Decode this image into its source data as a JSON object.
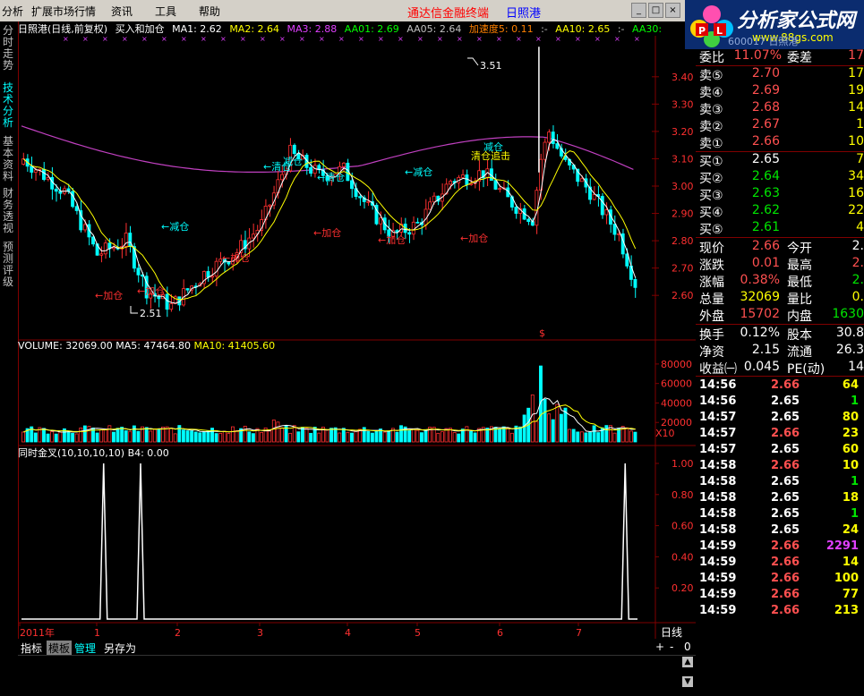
{
  "menu": [
    "分析",
    "扩展市场行情",
    "资讯",
    "工具",
    "帮助"
  ],
  "brand": {
    "title": "通达信金融终端",
    "stock": "日照港"
  },
  "logo": {
    "text": "分析家公式网",
    "url": "www.88gs.com",
    "code": "600017 日照港"
  },
  "side_tabs": [
    "分时走势",
    "技术分析",
    "基本资料",
    "财务透视",
    "预测评级"
  ],
  "info": {
    "name": "日照港(日线,前复权)",
    "formula": "买入和加仓",
    "items": [
      {
        "label": "MA1: 2.62",
        "color": "#ffffff"
      },
      {
        "label": "MA2: 2.64",
        "color": "#ffff00"
      },
      {
        "label": "MA3: 2.88",
        "color": "#e040ff"
      },
      {
        "label": "AA01: 2.69",
        "color": "#00ff00"
      },
      {
        "label": "AA05: 2.64",
        "color": "#c0c0c0"
      },
      {
        "label": "加速度5: 0.11",
        "color": "#ff8000"
      },
      {
        "label": ":-",
        "color": "#c0c0c0"
      },
      {
        "label": "AA10: 2.65",
        "color": "#ffff00"
      },
      {
        "label": ":-",
        "color": "#c0c0c0"
      },
      {
        "label": "AA30:",
        "color": "#00ff00"
      }
    ]
  },
  "price_axis": [
    "3.40",
    "3.30",
    "3.20",
    "3.10",
    "3.00",
    "2.90",
    "2.80",
    "2.70",
    "2.60"
  ],
  "annotations": {
    "high": "3.51",
    "low": "2.51",
    "dollar": "$",
    "labels": [
      {
        "text": "←加仓",
        "color": "#ff3030"
      },
      {
        "text": "←加仓",
        "color": "#ff3030"
      },
      {
        "text": "←减仓",
        "color": "#00ffff"
      },
      {
        "text": "←加仓",
        "color": "#ff3030"
      },
      {
        "text": "←清仓",
        "color": "#00ffff"
      },
      {
        "text": "减仓",
        "color": "#00ffff"
      },
      {
        "text": "←清仓",
        "color": "#00ffff"
      },
      {
        "text": "←加仓",
        "color": "#ff3030"
      },
      {
        "text": "←加仓",
        "color": "#ff3030"
      },
      {
        "text": "←减仓",
        "color": "#00ffff"
      },
      {
        "text": "←加仓",
        "color": "#ff3030"
      },
      {
        "text": "减仓",
        "color": "#00ffff"
      },
      {
        "text": "清仓追击",
        "color": "#ffff00"
      }
    ]
  },
  "volume": {
    "label": "VOLUME: 32069.00",
    "ma5": "MA5: 47464.80",
    "ma10": "MA10: 41405.60",
    "axis": [
      "80000",
      "60000",
      "40000",
      "20000"
    ],
    "unit": "X10"
  },
  "indicator": {
    "label": "同时金叉(10,10,10,10)",
    "b4": "B4: 0.00",
    "axis": [
      "1.00",
      "0.80",
      "0.60",
      "0.40",
      "0.20"
    ]
  },
  "time_axis": [
    "2011年",
    "1",
    "2",
    "3",
    "4",
    "5",
    "6",
    "7"
  ],
  "period": "日线",
  "bottom_tabs": [
    "指标",
    "模板",
    "管理",
    "另存为"
  ],
  "bottom_ctrl": [
    "+",
    "-",
    "0"
  ],
  "quote": {
    "weibi": {
      "label": "委比",
      "value": "11.07%",
      "label2": "委差",
      "value2": "17"
    },
    "asks": [
      {
        "label": "卖⑤",
        "price": "2.70",
        "vol": "17"
      },
      {
        "label": "卖④",
        "price": "2.69",
        "vol": "19"
      },
      {
        "label": "卖③",
        "price": "2.68",
        "vol": "14"
      },
      {
        "label": "卖②",
        "price": "2.67",
        "vol": "1"
      },
      {
        "label": "卖①",
        "price": "2.66",
        "vol": "10"
      }
    ],
    "bids": [
      {
        "label": "买①",
        "price": "2.65",
        "vol": "7"
      },
      {
        "label": "买②",
        "price": "2.64",
        "vol": "34"
      },
      {
        "label": "买③",
        "price": "2.63",
        "vol": "16"
      },
      {
        "label": "买④",
        "price": "2.62",
        "vol": "22"
      },
      {
        "label": "买⑤",
        "price": "2.61",
        "vol": "4"
      }
    ],
    "stats": [
      {
        "l": "现价",
        "v": "2.66",
        "vc": "red",
        "l2": "今开",
        "v2": "2.",
        "v2c": "white"
      },
      {
        "l": "涨跌",
        "v": "0.01",
        "vc": "red",
        "l2": "最高",
        "v2": "2.",
        "v2c": "red"
      },
      {
        "l": "涨幅",
        "v": "0.38%",
        "vc": "red",
        "l2": "最低",
        "v2": "2.",
        "v2c": "green"
      },
      {
        "l": "总量",
        "v": "32069",
        "vc": "yellow",
        "l2": "量比",
        "v2": "0.",
        "v2c": "yellow"
      },
      {
        "l": "外盘",
        "v": "15702",
        "vc": "red",
        "l2": "内盘",
        "v2": "1630",
        "v2c": "green"
      }
    ],
    "stats2": [
      {
        "l": "换手",
        "v": "0.12%",
        "l2": "股本",
        "v2": "30.8"
      },
      {
        "l": "净资",
        "v": "2.15",
        "l2": "流通",
        "v2": "26.3"
      },
      {
        "l": "收益㈠",
        "v": "0.045",
        "l2": "PE(动)",
        "v2": "14"
      }
    ],
    "ticks": [
      {
        "t": "14:56",
        "p": "2.66",
        "pc": "red",
        "q": "64",
        "qc": "yellow"
      },
      {
        "t": "14:56",
        "p": "2.65",
        "pc": "white",
        "q": "1",
        "qc": "green"
      },
      {
        "t": "14:57",
        "p": "2.65",
        "pc": "white",
        "q": "80",
        "qc": "yellow"
      },
      {
        "t": "14:57",
        "p": "2.66",
        "pc": "red",
        "q": "23",
        "qc": "yellow"
      },
      {
        "t": "14:57",
        "p": "2.65",
        "pc": "white",
        "q": "60",
        "qc": "yellow"
      },
      {
        "t": "14:58",
        "p": "2.66",
        "pc": "red",
        "q": "10",
        "qc": "yellow"
      },
      {
        "t": "14:58",
        "p": "2.65",
        "pc": "white",
        "q": "1",
        "qc": "green"
      },
      {
        "t": "14:58",
        "p": "2.65",
        "pc": "white",
        "q": "18",
        "qc": "yellow"
      },
      {
        "t": "14:58",
        "p": "2.65",
        "pc": "white",
        "q": "1",
        "qc": "green"
      },
      {
        "t": "14:58",
        "p": "2.65",
        "pc": "white",
        "q": "24",
        "qc": "yellow"
      },
      {
        "t": "14:59",
        "p": "2.66",
        "pc": "red",
        "q": "2291",
        "qc": "magenta"
      },
      {
        "t": "14:59",
        "p": "2.66",
        "pc": "red",
        "q": "14",
        "qc": "yellow"
      },
      {
        "t": "14:59",
        "p": "2.66",
        "pc": "red",
        "q": "100",
        "qc": "yellow"
      },
      {
        "t": "14:59",
        "p": "2.66",
        "pc": "red",
        "q": "77",
        "qc": "yellow"
      },
      {
        "t": "14:59",
        "p": "2.66",
        "pc": "red",
        "q": "213",
        "qc": "yellow"
      }
    ]
  },
  "colors": {
    "up": "#ff3030",
    "down": "#00ffff",
    "ma_white": "#ffffff",
    "ma_yellow": "#ffff00",
    "ma_magenta": "#c040c0",
    "axis_red": "#800000"
  }
}
